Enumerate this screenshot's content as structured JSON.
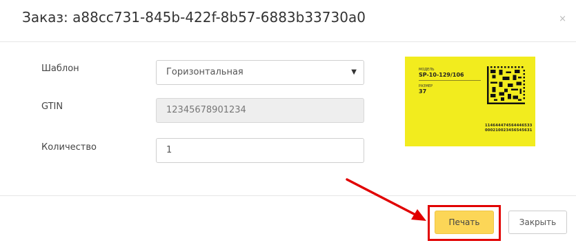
{
  "dialog": {
    "title": "Заказ: a88cc731-845b-422f-8b57-6883b33730a0",
    "close_symbol": "×"
  },
  "form": {
    "template_label": "Шаблон",
    "template_value": "Горизонтальная",
    "gtin_label": "GTIN",
    "gtin_value": "12345678901234",
    "quantity_label": "Количество",
    "quantity_value": "1"
  },
  "label_preview": {
    "model_caption": "МОДЕЛЬ",
    "model_value": "SP-10-129/106",
    "size_caption": "РАЗМЕР",
    "size_value": "37",
    "code_line1": "114644474564446533",
    "code_line2": "000210023456545631",
    "background_color": "#f2ec1e",
    "qr_icon": "datamatrix-code-icon"
  },
  "footer": {
    "print_label": "Печать",
    "close_label": "Закрыть"
  },
  "colors": {
    "accent": "#fcd657",
    "highlight": "#e10000"
  }
}
